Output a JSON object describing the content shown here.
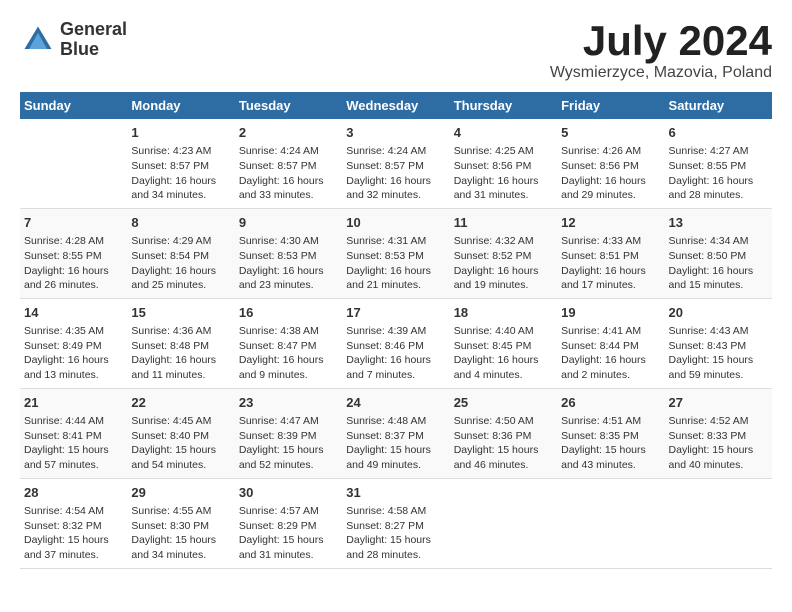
{
  "logo": {
    "line1": "General",
    "line2": "Blue"
  },
  "title": "July 2024",
  "location": "Wysmierzyce, Mazovia, Poland",
  "headers": [
    "Sunday",
    "Monday",
    "Tuesday",
    "Wednesday",
    "Thursday",
    "Friday",
    "Saturday"
  ],
  "weeks": [
    [
      {
        "day": "",
        "info": ""
      },
      {
        "day": "1",
        "info": "Sunrise: 4:23 AM\nSunset: 8:57 PM\nDaylight: 16 hours\nand 34 minutes."
      },
      {
        "day": "2",
        "info": "Sunrise: 4:24 AM\nSunset: 8:57 PM\nDaylight: 16 hours\nand 33 minutes."
      },
      {
        "day": "3",
        "info": "Sunrise: 4:24 AM\nSunset: 8:57 PM\nDaylight: 16 hours\nand 32 minutes."
      },
      {
        "day": "4",
        "info": "Sunrise: 4:25 AM\nSunset: 8:56 PM\nDaylight: 16 hours\nand 31 minutes."
      },
      {
        "day": "5",
        "info": "Sunrise: 4:26 AM\nSunset: 8:56 PM\nDaylight: 16 hours\nand 29 minutes."
      },
      {
        "day": "6",
        "info": "Sunrise: 4:27 AM\nSunset: 8:55 PM\nDaylight: 16 hours\nand 28 minutes."
      }
    ],
    [
      {
        "day": "7",
        "info": "Sunrise: 4:28 AM\nSunset: 8:55 PM\nDaylight: 16 hours\nand 26 minutes."
      },
      {
        "day": "8",
        "info": "Sunrise: 4:29 AM\nSunset: 8:54 PM\nDaylight: 16 hours\nand 25 minutes."
      },
      {
        "day": "9",
        "info": "Sunrise: 4:30 AM\nSunset: 8:53 PM\nDaylight: 16 hours\nand 23 minutes."
      },
      {
        "day": "10",
        "info": "Sunrise: 4:31 AM\nSunset: 8:53 PM\nDaylight: 16 hours\nand 21 minutes."
      },
      {
        "day": "11",
        "info": "Sunrise: 4:32 AM\nSunset: 8:52 PM\nDaylight: 16 hours\nand 19 minutes."
      },
      {
        "day": "12",
        "info": "Sunrise: 4:33 AM\nSunset: 8:51 PM\nDaylight: 16 hours\nand 17 minutes."
      },
      {
        "day": "13",
        "info": "Sunrise: 4:34 AM\nSunset: 8:50 PM\nDaylight: 16 hours\nand 15 minutes."
      }
    ],
    [
      {
        "day": "14",
        "info": "Sunrise: 4:35 AM\nSunset: 8:49 PM\nDaylight: 16 hours\nand 13 minutes."
      },
      {
        "day": "15",
        "info": "Sunrise: 4:36 AM\nSunset: 8:48 PM\nDaylight: 16 hours\nand 11 minutes."
      },
      {
        "day": "16",
        "info": "Sunrise: 4:38 AM\nSunset: 8:47 PM\nDaylight: 16 hours\nand 9 minutes."
      },
      {
        "day": "17",
        "info": "Sunrise: 4:39 AM\nSunset: 8:46 PM\nDaylight: 16 hours\nand 7 minutes."
      },
      {
        "day": "18",
        "info": "Sunrise: 4:40 AM\nSunset: 8:45 PM\nDaylight: 16 hours\nand 4 minutes."
      },
      {
        "day": "19",
        "info": "Sunrise: 4:41 AM\nSunset: 8:44 PM\nDaylight: 16 hours\nand 2 minutes."
      },
      {
        "day": "20",
        "info": "Sunrise: 4:43 AM\nSunset: 8:43 PM\nDaylight: 15 hours\nand 59 minutes."
      }
    ],
    [
      {
        "day": "21",
        "info": "Sunrise: 4:44 AM\nSunset: 8:41 PM\nDaylight: 15 hours\nand 57 minutes."
      },
      {
        "day": "22",
        "info": "Sunrise: 4:45 AM\nSunset: 8:40 PM\nDaylight: 15 hours\nand 54 minutes."
      },
      {
        "day": "23",
        "info": "Sunrise: 4:47 AM\nSunset: 8:39 PM\nDaylight: 15 hours\nand 52 minutes."
      },
      {
        "day": "24",
        "info": "Sunrise: 4:48 AM\nSunset: 8:37 PM\nDaylight: 15 hours\nand 49 minutes."
      },
      {
        "day": "25",
        "info": "Sunrise: 4:50 AM\nSunset: 8:36 PM\nDaylight: 15 hours\nand 46 minutes."
      },
      {
        "day": "26",
        "info": "Sunrise: 4:51 AM\nSunset: 8:35 PM\nDaylight: 15 hours\nand 43 minutes."
      },
      {
        "day": "27",
        "info": "Sunrise: 4:52 AM\nSunset: 8:33 PM\nDaylight: 15 hours\nand 40 minutes."
      }
    ],
    [
      {
        "day": "28",
        "info": "Sunrise: 4:54 AM\nSunset: 8:32 PM\nDaylight: 15 hours\nand 37 minutes."
      },
      {
        "day": "29",
        "info": "Sunrise: 4:55 AM\nSunset: 8:30 PM\nDaylight: 15 hours\nand 34 minutes."
      },
      {
        "day": "30",
        "info": "Sunrise: 4:57 AM\nSunset: 8:29 PM\nDaylight: 15 hours\nand 31 minutes."
      },
      {
        "day": "31",
        "info": "Sunrise: 4:58 AM\nSunset: 8:27 PM\nDaylight: 15 hours\nand 28 minutes."
      },
      {
        "day": "",
        "info": ""
      },
      {
        "day": "",
        "info": ""
      },
      {
        "day": "",
        "info": ""
      }
    ]
  ]
}
